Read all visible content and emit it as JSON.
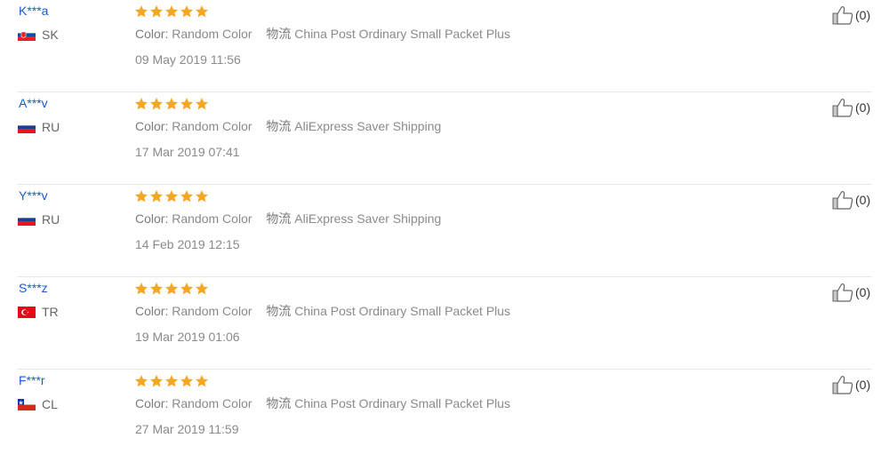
{
  "reviews": [
    {
      "name": "K***a",
      "country": "SK",
      "flag": "sk-flag-icon",
      "stars": 5,
      "color_label": "Color:",
      "color_value": "Random Color",
      "shipping_label": "物流",
      "shipping_value": "China Post Ordinary Small Packet Plus",
      "date": "09 May 2019 11:56",
      "likes": "(0)"
    },
    {
      "name": "A***v",
      "country": "RU",
      "flag": "ru-flag-icon",
      "stars": 5,
      "color_label": "Color:",
      "color_value": "Random Color",
      "shipping_label": "物流",
      "shipping_value": "AliExpress Saver Shipping",
      "date": "17 Mar 2019 07:41",
      "likes": "(0)"
    },
    {
      "name": "Y***v",
      "country": "RU",
      "flag": "ru-flag-icon",
      "stars": 5,
      "color_label": "Color:",
      "color_value": "Random Color",
      "shipping_label": "物流",
      "shipping_value": "AliExpress Saver Shipping",
      "date": "14 Feb 2019 12:15",
      "likes": "(0)"
    },
    {
      "name": "S***z",
      "country": "TR",
      "flag": "tr-flag-icon",
      "stars": 5,
      "color_label": "Color:",
      "color_value": "Random Color",
      "shipping_label": "物流",
      "shipping_value": "China Post Ordinary Small Packet Plus",
      "date": "19 Mar 2019 01:06",
      "likes": "(0)"
    },
    {
      "name": "F***r",
      "country": "CL",
      "flag": "cl-flag-icon",
      "stars": 5,
      "color_label": "Color:",
      "color_value": "Random Color",
      "shipping_label": "物流",
      "shipping_value": "China Post Ordinary Small Packet Plus",
      "date": "27 Mar 2019 11:59",
      "likes": "(0)"
    }
  ],
  "colors": {
    "name": "#1a5ac8",
    "star": "#f5a623",
    "text": "#8a8a8a"
  }
}
